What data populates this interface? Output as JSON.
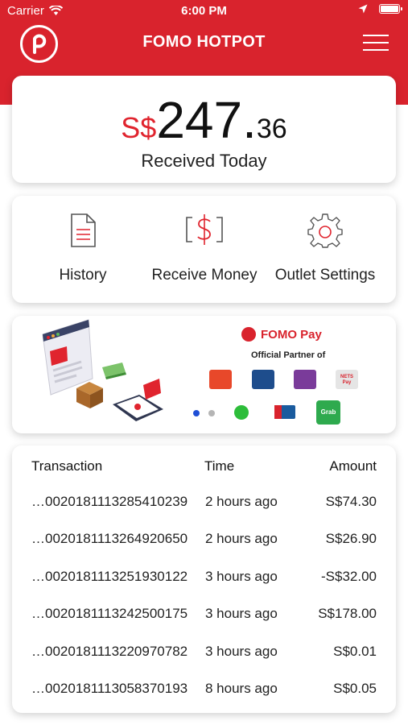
{
  "status_bar": {
    "carrier": "Carrier",
    "time": "6:00 PM"
  },
  "header": {
    "title": "FOMO HOTPOT",
    "logo_icon": "fomo-logo-icon",
    "menu_icon": "hamburger-menu-icon"
  },
  "balance": {
    "currency": "S$",
    "whole": "247.",
    "decimal": "36",
    "label": "Received Today"
  },
  "actions": [
    {
      "label": "History",
      "icon": "document-icon"
    },
    {
      "label": "Receive Money",
      "icon": "money-icon"
    },
    {
      "label": "Outlet Settings",
      "icon": "gear-icon"
    }
  ],
  "banner": {
    "brand": "FOMO Pay",
    "tagline": "Official Partner of",
    "partner_labels": [
      "NETS Pay",
      "Grab"
    ],
    "carousel_total": 2,
    "carousel_active": 1
  },
  "transactions": {
    "headers": {
      "id": "Transaction",
      "time": "Time",
      "amount": "Amount"
    },
    "rows": [
      {
        "id": "…0020181113285410239",
        "time": "2 hours ago",
        "amount": "S$74.30"
      },
      {
        "id": "…0020181113264920650",
        "time": "2 hours ago",
        "amount": "S$26.90"
      },
      {
        "id": "…0020181113251930122",
        "time": "3 hours ago",
        "amount": "-S$32.00"
      },
      {
        "id": "…0020181113242500175",
        "time": "3 hours ago",
        "amount": "S$178.00"
      },
      {
        "id": "…0020181113220970782",
        "time": "3 hours ago",
        "amount": "S$0.01"
      },
      {
        "id": "…0020181113058370193",
        "time": "8 hours ago",
        "amount": "S$0.05"
      }
    ]
  },
  "colors": {
    "brand_red": "#d9232d",
    "accent_red": "#e0242e"
  }
}
